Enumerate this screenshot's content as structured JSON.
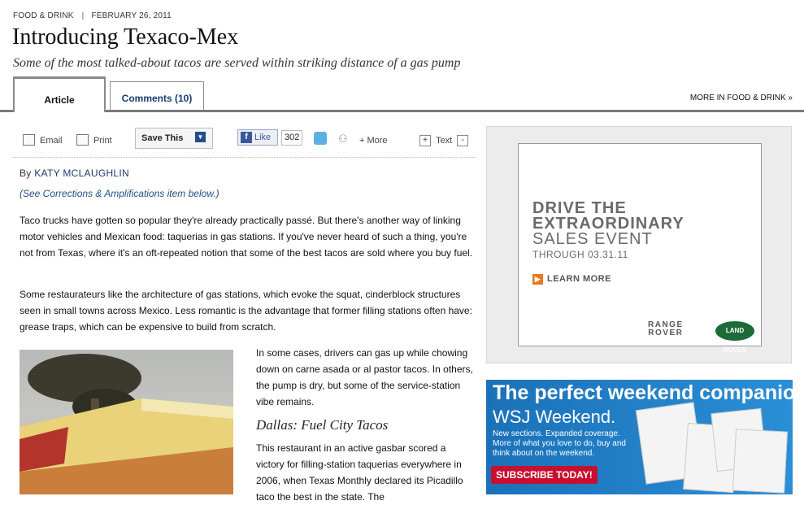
{
  "header": {
    "section": "FOOD & DRINK",
    "separator": "|",
    "date": "FEBRUARY 26, 2011",
    "title": "Introducing Texaco-Mex",
    "dek": "Some of the most talked-about tacos are served within striking distance of a gas pump"
  },
  "tabs": [
    {
      "label": "Article",
      "active": true
    },
    {
      "label": "Comments (10)",
      "active": false
    }
  ],
  "more_link": "MORE IN FOOD & DRINK »",
  "toolbar": {
    "email": "Email",
    "print": "Print",
    "save": "Save This",
    "like": "Like",
    "like_count": "302",
    "more": "+ More",
    "text": "Text",
    "text_increase": "+",
    "text_decrease": "-"
  },
  "article": {
    "byline_prefix": "By",
    "author": "KATY MCLAUGHLIN",
    "corrections": "(See Corrections & Amplifications item below.)",
    "paragraphs": [
      "Taco trucks have gotten so popular they're already practically passé. But there's another way of linking motor vehicles and Mexican food: taquerias in gas stations. If you've never heard of such a thing, you're not from Texas, where it's an oft-repeated notion that some of the best tacos are sold where you buy fuel.",
      "Some restaurateurs like the architecture of gas stations, which evoke the squat, cinderblock structures seen in small towns across Mexico. Less romantic is the advantage that former filling stations often have: grease traps, which can be expensive to build from scratch.",
      "In some cases, drivers can gas up while chowing down on carne asada or al pastor tacos. In others, the pump is dry, but some of the service-station vibe remains.",
      "This restaurant in an active gasbar scored a victory for filling-station taquerias everywhere in 2006, when Texas Monthly declared its Picadillo taco the best in the state. The"
    ],
    "subhead": "Dallas: Fuel City Tacos"
  },
  "ads": {
    "range_rover": {
      "line1": "DRIVE THE",
      "line2": "EXTRAORDINARY",
      "line3": "SALES EVENT",
      "through": "THROUGH 03.31.11",
      "cta": "LEARN MORE",
      "brand1_a": "RANGE",
      "brand1_b": "ROVER",
      "brand2": "LAND ROVER"
    },
    "wsj": {
      "headline": "The perfect weekend companion.",
      "name": "WSJ Weekend.",
      "body": "New sections. Expanded coverage. More of what you love to do, buy and think about on the weekend.",
      "cta": "SUBSCRIBE TODAY!"
    }
  }
}
